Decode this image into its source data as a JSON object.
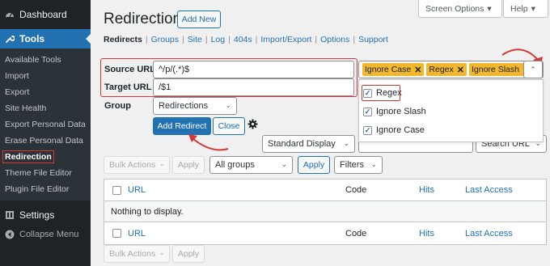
{
  "sidebar": {
    "dashboard": "Dashboard",
    "tools": "Tools",
    "sub_items": [
      "Available Tools",
      "Import",
      "Export",
      "Site Health",
      "Export Personal Data",
      "Erase Personal Data",
      "Redirection",
      "Theme File Editor",
      "Plugin File Editor"
    ],
    "current_index": 6,
    "settings": "Settings",
    "collapse": "Collapse Menu"
  },
  "topbar": {
    "screen_options": "Screen Options",
    "help": "Help"
  },
  "page": {
    "title": "Redirections",
    "add_new": "Add New"
  },
  "subnav": [
    "Redirects",
    "Groups",
    "Site",
    "Log",
    "404s",
    "Import/Export",
    "Options",
    "Support"
  ],
  "form": {
    "source_label": "Source URL",
    "source_value": "^/p/(.*)$",
    "target_label": "Target URL",
    "target_value": "/$1",
    "group_label": "Group",
    "group_value": "Redirections",
    "add_redirect": "Add Redirect",
    "close": "Close"
  },
  "flags": {
    "tags": [
      "Ignore Case",
      "Regex",
      "Ignore Slash"
    ],
    "options": [
      {
        "label": "Regex",
        "checked": true
      },
      {
        "label": "Ignore Slash",
        "checked": true
      },
      {
        "label": "Ignore Case",
        "checked": true
      }
    ]
  },
  "filters": {
    "display": "Standard Display",
    "search_by": "Search URL",
    "bulk_actions": "Bulk Actions",
    "apply": "Apply",
    "group_filter": "All groups",
    "filters": "Filters"
  },
  "table": {
    "columns": [
      "URL",
      "Code",
      "Hits",
      "Last Access"
    ],
    "empty": "Nothing to display."
  },
  "colors": {
    "accent": "#2271b1",
    "sidebar": "#1d2327",
    "tag": "#f0b72f",
    "highlight": "#d63638"
  }
}
